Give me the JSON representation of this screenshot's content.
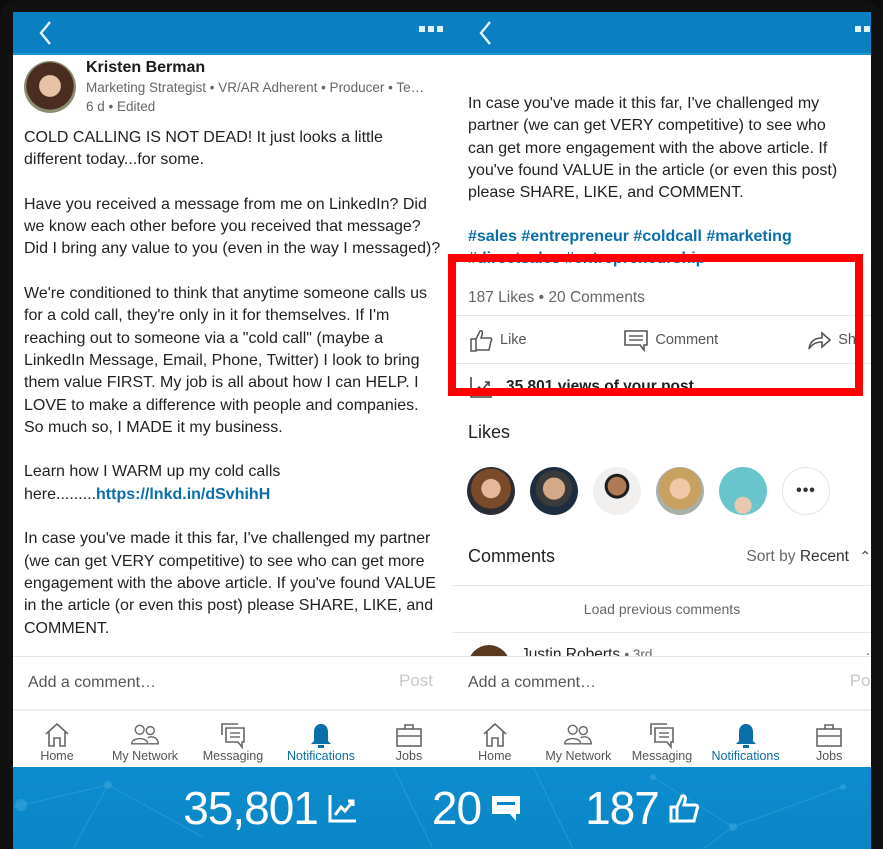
{
  "left_screen": {
    "post": {
      "author": {
        "name": "Kristen Berman",
        "headline": "Marketing Strategist • VR/AR Adherent • Producer • Te…",
        "meta": "6 d • Edited"
      },
      "paragraphs": [
        "COLD CALLING IS NOT DEAD! It just looks a little different today...for some.",
        "Have you received a message from me on LinkedIn? Did we know each other before you received that message? Did I bring any value to you (even in the way I messaged)?",
        "We're conditioned to think that anytime someone calls us for a cold call, they're only in it for themselves. If I'm reaching out to someone via a \"cold call\" (maybe a LinkedIn Message, Email, Phone, Twitter) I look to bring them value FIRST. My job is all about how I can HELP. I LOVE to make a difference with people and companies. So much so, I MADE it my business.",
        "Learn how I WARM up my cold calls here.........",
        "In case you've made it this far, I've challenged my partner (we can get VERY competitive) to see who can get more engagement with the above article. If you've found VALUE in the article (or even this post) please SHARE, LIKE, and COMMENT."
      ],
      "link": "https://lnkd.in/dSvhihH"
    },
    "composer": {
      "placeholder": "Add a comment…",
      "post_label": "Post"
    }
  },
  "right_screen": {
    "closing_paragraph": "In case you've made it this far, I've challenged my partner (we can get VERY competitive) to see who can get more engagement with the above article. If you've found VALUE in the article (or even this post) please SHARE, LIKE, and COMMENT.",
    "hashtags": "#sales #entrepreneur #coldcall #marketing #directsales #entrepreneurship",
    "social_counts": "187 Likes • 20 Comments",
    "actions": {
      "like": "Like",
      "comment": "Comment",
      "share": "Sh"
    },
    "views_text": "35,801 views of your post",
    "likes_title": "Likes",
    "likers_more": "•••",
    "comments": {
      "title": "Comments",
      "sort_prefix": "Sort by",
      "sort_value": "Recent",
      "load_previous": "Load previous comments",
      "first_comment": {
        "name": "Justin Roberts",
        "degree": "• 3rd"
      }
    },
    "composer": {
      "placeholder": "Add a comment…",
      "post_label": "Pos"
    }
  },
  "tabbar": {
    "tabs": [
      {
        "label": "Home",
        "icon": "home-icon"
      },
      {
        "label": "My Network",
        "icon": "network-icon"
      },
      {
        "label": "Messaging",
        "icon": "messaging-icon"
      },
      {
        "label": "Notifications",
        "icon": "bell-icon",
        "active": true
      },
      {
        "label": "Jobs",
        "icon": "briefcase-icon"
      }
    ]
  },
  "banner": {
    "views": "35,801",
    "comments": "20",
    "likes": "187"
  },
  "colors": {
    "brand_blue": "#0a7fc1",
    "link_blue": "#0a6ea8",
    "highlight_red": "#ff0000",
    "banner_blue": "#0c8ccf"
  }
}
